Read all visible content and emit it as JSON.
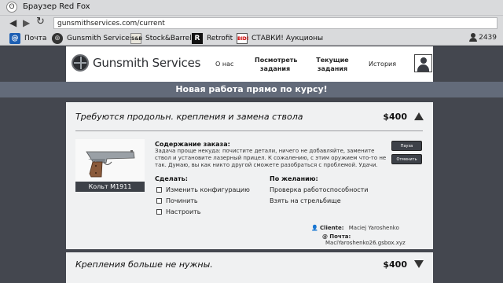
{
  "browser": {
    "title": "Браузер Red Fox",
    "url": "gunsmithservices.com/current",
    "bookmarks": [
      {
        "label": "Почта",
        "icon": "mail-icon"
      },
      {
        "label": "Gunsmith Services",
        "icon": "gunsmith-logo-icon"
      },
      {
        "label": "Stock&Barrel",
        "icon": "stock-barrel-icon",
        "icon_text": "S&B"
      },
      {
        "label": "Retrofit",
        "icon": "retrofit-icon",
        "icon_text": "R"
      },
      {
        "label": "СТАВКИ! Аукционы",
        "icon": "bid-icon",
        "icon_text": "BID!"
      }
    ],
    "user_count": "2439"
  },
  "site": {
    "logo": "Gunsmith Services",
    "nav": [
      {
        "label": "О нас"
      },
      {
        "label": "Посмотреть\nзадания"
      },
      {
        "label": "Текущие\nзадания"
      },
      {
        "label": "История"
      }
    ],
    "banner": "Новая работа прямо по курсу!"
  },
  "jobs": [
    {
      "title": "Требуются продольн. крепления и замена ствола",
      "price": "$400",
      "expanded": true,
      "gun_name": "Кольт M1911",
      "summary_label": "Содержание заказа:",
      "summary": "Задача проще некуда: почистите детали, ничего не добавляйте, замените ствол и установите лазерный прицел. К сожалению, с этим оружием что-то не так. Думаю, вы как никто другой сможете разобраться с проблемой. Удачи.",
      "pause_label": "Пауза",
      "cancel_label": "Отменить",
      "todo_label": "Сделать:",
      "todo": [
        "Изменить конфигурацию",
        "Починить",
        "Настроить"
      ],
      "optional_label": "По желанию:",
      "optional": [
        "Проверка работоспособности",
        "Взять на стрельбище"
      ],
      "client_label": "Cliente:",
      "client": "Maciej Yaroshenko",
      "mail_label": "Почта:",
      "mail": "MaciYaroshenko26.gsbox.xyz"
    },
    {
      "title": "Крепления больше не нужны.",
      "price": "$400",
      "expanded": false
    }
  ],
  "colors": {
    "banner": "#636b7a",
    "page_bg": "#44474f",
    "card_bg": "#f0f1f2",
    "dark_button": "#3d4148"
  }
}
